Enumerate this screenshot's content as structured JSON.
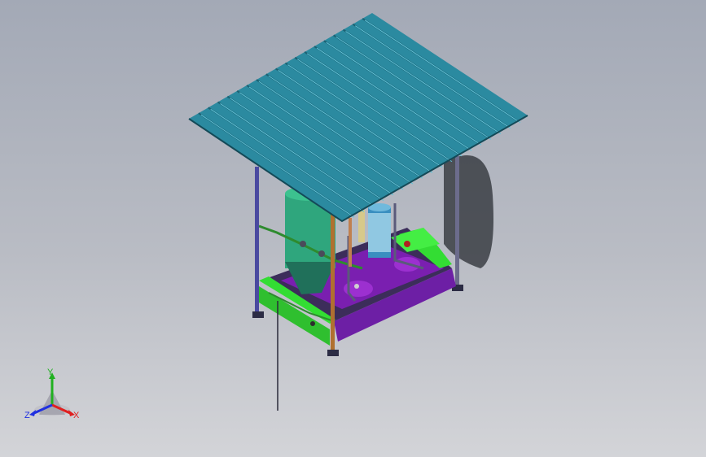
{
  "viewport": {
    "background_top": "#a3a9b6",
    "background_bottom": "#d3d4d8"
  },
  "model": {
    "roof_color": "#2b8aa0",
    "roof_rib_color": "#1c6273",
    "frame_color": "#33dd33",
    "base_color": "#7a1fb0",
    "tank_color": "#2fa67d",
    "filter_color": "#3a8fc0",
    "post_color": "#6c6c8c"
  },
  "triad": {
    "x_label": "X",
    "y_label": "Y",
    "z_label": "Z",
    "x_color": "#e02020",
    "y_color": "#20b020",
    "z_color": "#2030e0"
  }
}
